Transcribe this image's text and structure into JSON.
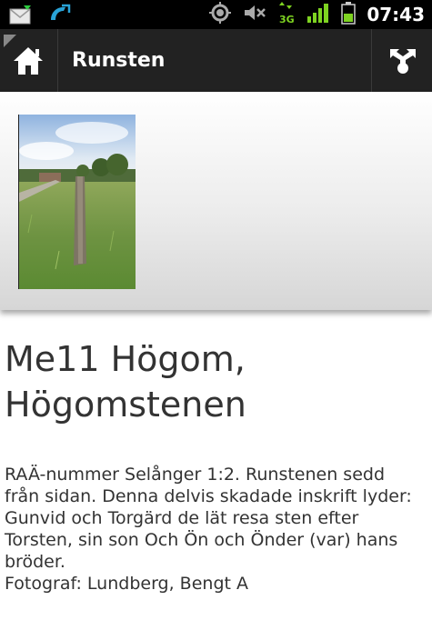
{
  "status_bar": {
    "time": "07:43",
    "network": "3G",
    "icons": [
      "mail-icon",
      "missed-call-icon",
      "gps-icon",
      "mute-icon",
      "3g-data-icon",
      "signal-icon",
      "battery-icon"
    ]
  },
  "action_bar": {
    "title": "Runsten",
    "home_icon": "home-icon",
    "share_icon": "share-icon"
  },
  "gallery": {
    "photo_description": "photo-thumbnail"
  },
  "content": {
    "heading": "Me11 Högom, Högomstenen",
    "description": "RAÄ-nummer Selånger 1:2. Runstenen sedd från sidan. Denna delvis skadade inskrift lyder: Gunvid och Torgärd de lät resa sten efter Torsten, sin son Och Ön och Önder (var) hans bröder.",
    "photographer": "Fotograf: Lundberg, Bengt A"
  },
  "colors": {
    "action_bar": "#222222",
    "status_bar": "#000000",
    "text": "#333333",
    "battery_signal": "#7ed321"
  }
}
